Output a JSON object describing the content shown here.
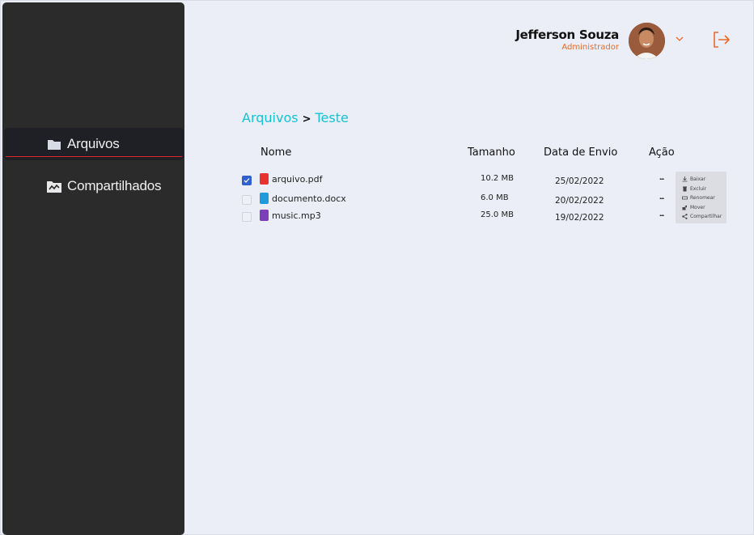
{
  "sidebar": {
    "items": [
      {
        "label": "Arquivos",
        "icon": "folder-icon",
        "active": true
      },
      {
        "label": "Compartilhados",
        "icon": "shared-folder-icon",
        "active": false
      }
    ]
  },
  "header": {
    "user_name": "Jefferson Souza",
    "user_role": "Administrador"
  },
  "breadcrumb": {
    "root": "Arquivos",
    "separator": ">",
    "current": "Teste"
  },
  "table": {
    "columns": [
      "Nome",
      "Tamanho",
      "Data de Envio",
      "Ação"
    ],
    "rows": [
      {
        "name": "arquivo.pdf",
        "size": "10.2 MB",
        "date": "25/02/2022",
        "checked": true,
        "type": "pdf"
      },
      {
        "name": "documento.docx",
        "size": "6.0 MB",
        "date": "20/02/2022",
        "checked": false,
        "type": "docx"
      },
      {
        "name": "music.mp3",
        "size": "25.0 MB",
        "date": "19/02/2022",
        "checked": false,
        "type": "mp3"
      }
    ],
    "action_label": "..."
  },
  "action_menu": {
    "items": [
      "Baixar",
      "Excluir",
      "Renomear",
      "Mover",
      "Compartilhar"
    ]
  },
  "colors": {
    "accent": "#17c2d4",
    "danger": "#e0282a",
    "role": "#ea6a2a",
    "sidebar": "#2c2b2b",
    "background": "#ebeef6"
  }
}
